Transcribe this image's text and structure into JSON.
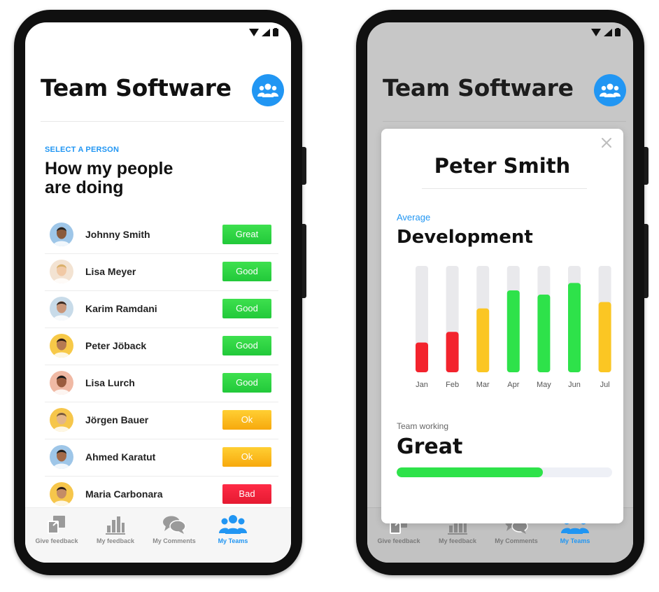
{
  "app_title": "Team Software",
  "select_label": "SELECT A PERSON",
  "people_title_line1": "How my people",
  "people_title_line2": "are doing",
  "people": [
    {
      "name": "Johnny Smith",
      "status": "Great",
      "level": "great",
      "skin": "#8a5a3c",
      "hair": "#222222",
      "bg": "#9ec6e8"
    },
    {
      "name": "Lisa Meyer",
      "status": "Good",
      "level": "good",
      "skin": "#f1c9a5",
      "hair": "#d9b06a",
      "bg": "#f3e3d2"
    },
    {
      "name": "Karim Ramdani",
      "status": "Good",
      "level": "good",
      "skin": "#c9977a",
      "hair": "#3a2a22",
      "bg": "#c8dbe9"
    },
    {
      "name": "Peter Jöback",
      "status": "Good",
      "level": "good",
      "skin": "#b57a52",
      "hair": "#2a1c14",
      "bg": "#f7c948"
    },
    {
      "name": "Lisa Lurch",
      "status": "Good",
      "level": "good",
      "skin": "#9b5c3e",
      "hair": "#1b1b1b",
      "bg": "#f0b9a4"
    },
    {
      "name": "Jörgen Bauer",
      "status": "Ok",
      "level": "ok",
      "skin": "#e2b58a",
      "hair": "#7a5a3a",
      "bg": "#f6c64b"
    },
    {
      "name": "Ahmed Karatut",
      "status": "Ok",
      "level": "ok",
      "skin": "#a36a48",
      "hair": "#1e1e1e",
      "bg": "#9ec6e8"
    },
    {
      "name": "Maria Carbonara",
      "status": "Bad",
      "level": "bad",
      "skin": "#c48c66",
      "hair": "#2b1c15",
      "bg": "#f6c64b"
    }
  ],
  "nav": [
    {
      "label": "Give feedback",
      "icon": "give-feedback-icon",
      "active": false
    },
    {
      "label": "My feedback",
      "icon": "bar-chart-icon",
      "active": false
    },
    {
      "label": "My Comments",
      "icon": "comments-icon",
      "active": false
    },
    {
      "label": "My Teams",
      "icon": "team-icon",
      "active": true
    }
  ],
  "modal": {
    "name": "Peter Smith",
    "average_label": "Average",
    "title": "Development",
    "team_label": "Team working",
    "team_value": "Great",
    "team_progress": 0.68
  },
  "colors": {
    "accent": "#2196f3",
    "great": "#2ee24a",
    "ok": "#fbc623",
    "bad": "#f3232d",
    "track": "#e9e9ec"
  },
  "chart_data": {
    "type": "bar",
    "categories": [
      "Jan",
      "Feb",
      "Mar",
      "Apr",
      "May",
      "Jun",
      "Jul"
    ],
    "values": [
      28,
      38,
      60,
      77,
      73,
      84,
      66
    ],
    "ylim": [
      0,
      100
    ],
    "bar_colors": [
      "#f3232d",
      "#f3232d",
      "#fbc623",
      "#2ee24a",
      "#2ee24a",
      "#2ee24a",
      "#fbc623"
    ],
    "grid": false
  }
}
